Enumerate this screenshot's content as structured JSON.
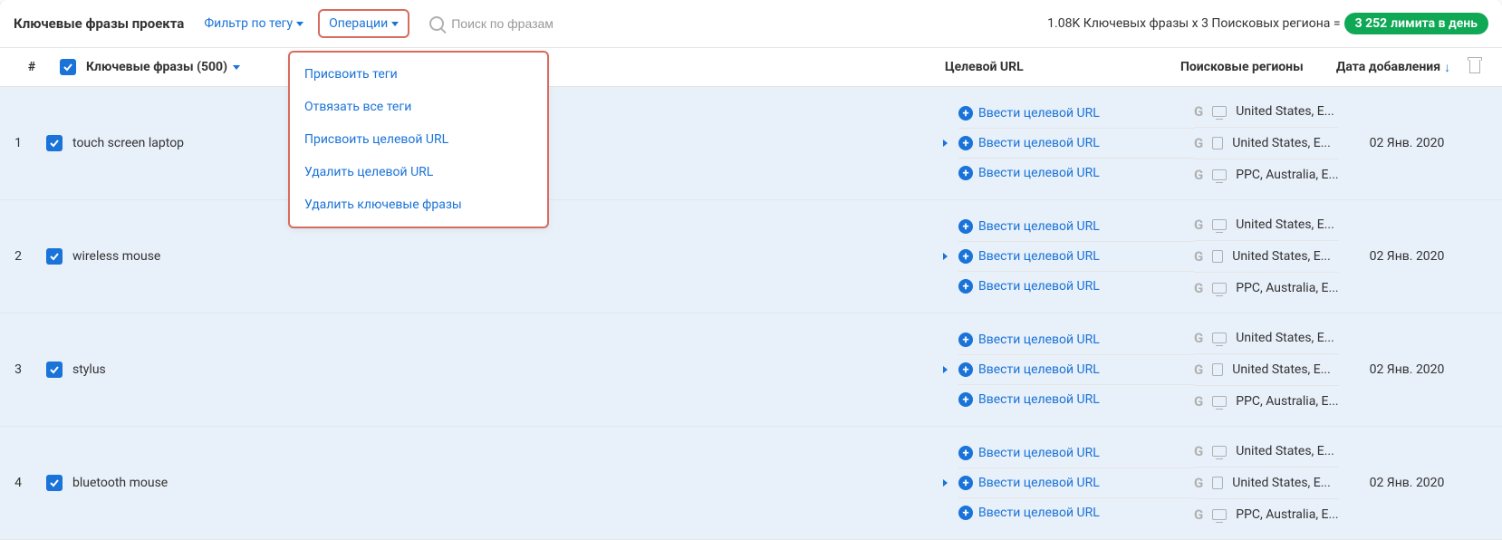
{
  "header": {
    "title": "Ключевые фразы проекта",
    "filter_label": "Фильтр по тегу",
    "operations_label": "Операции",
    "search_placeholder": "Поиск по фразам",
    "limit_prefix": "1.08K Ключевых фразы x 3 Поисковых региона =",
    "limit_count": "3 252",
    "limit_suffix": "лимита в день"
  },
  "columns": {
    "num": "#",
    "keywords": "Ключевые фразы (500)",
    "url": "Целевой URL",
    "regions": "Поисковые регионы",
    "date": "Дата добавления"
  },
  "dropdown": {
    "items": [
      "Присвоить теги",
      "Отвязать все теги",
      "Присвоить целевой URL",
      "Удалить целевой URL",
      "Удалить ключевые фразы"
    ]
  },
  "url_action": "Ввести целевой URL",
  "regions": {
    "r0": "United States, E...",
    "r1": "United States, E...",
    "r2": "PPC, Australia, E..."
  },
  "rows": [
    {
      "num": "1",
      "kw": "touch screen laptop",
      "date": "02 Янв. 2020"
    },
    {
      "num": "2",
      "kw": "wireless mouse",
      "date": "02 Янв. 2020"
    },
    {
      "num": "3",
      "kw": "stylus",
      "date": "02 Янв. 2020"
    },
    {
      "num": "4",
      "kw": "bluetooth mouse",
      "date": "02 Янв. 2020"
    }
  ]
}
